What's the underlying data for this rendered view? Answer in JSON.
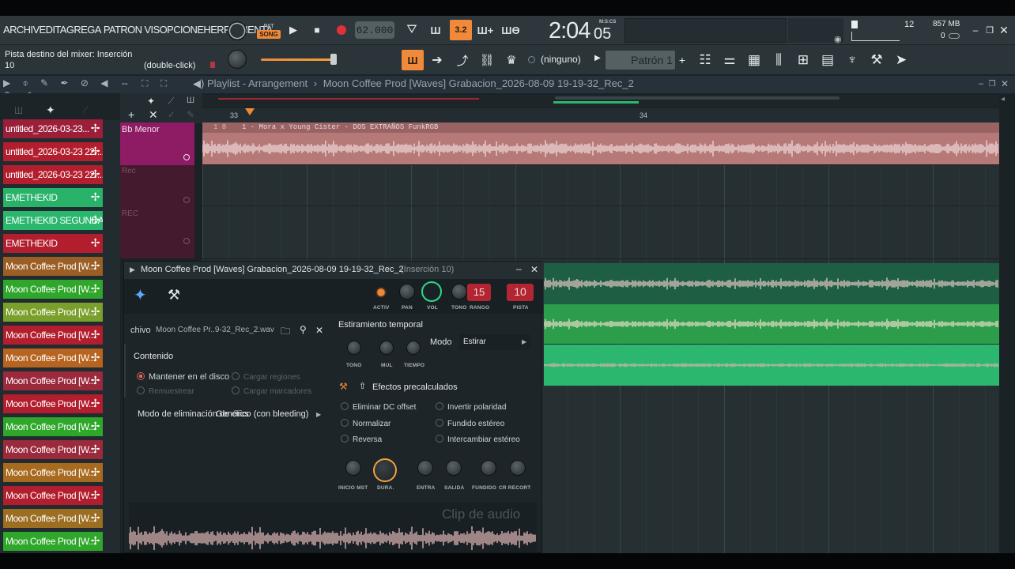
{
  "menu": {
    "items": [
      "ARCHIV",
      "EDITA",
      "GREGA",
      "PATRON",
      "VIS",
      "OPCIONE",
      "HERRAMIENTA"
    ]
  },
  "toolbar": {
    "song_mode_top": "PAT",
    "song_mode_bottom": "SONG",
    "tempo": "62.000",
    "snap_btn": "3.2",
    "time_main": "2:04",
    "time_sub": "05",
    "time_unit": "M:S:CS",
    "cpu_value": "12",
    "mem_value": "857 MB",
    "poly_value": "0",
    "hint_line1": "Pista destino del mixer: Inserción",
    "hint_line2": "10",
    "hint_right": "(double-click)",
    "preset_none": "(ninguno)",
    "pattern": "Patrón 1"
  },
  "playlist": {
    "window_title": "Playlist - Arrangement",
    "breadcrumb_sep": "›",
    "file": "Moon Coffee Prod [Waves] Grabacion_2026-08-09 19-19-32_Rec_2",
    "bar_33": "33",
    "bar_34": "34",
    "track1_name": "Bb Menor",
    "track2_name": "Rec",
    "track3_name": "REC",
    "clip_title": "1 - Mora x Young Cister - DOS EXTRAÑOS FunkRGB",
    "clip_prefix": "1 8"
  },
  "picker": [
    {
      "label": "untitled_2026-03-23...",
      "color": "#9c1f3a"
    },
    {
      "label": "untitled_2026-03-23 22-...",
      "color": "#b21e2d"
    },
    {
      "label": "untitled_2026-03-23 22-...",
      "color": "#b21e2d"
    },
    {
      "label": "EMETHEKID",
      "color": "#29b36a"
    },
    {
      "label": "EMETHEKID SEGUNDA...",
      "color": "#2bb86e"
    },
    {
      "label": "EMETHEKID",
      "color": "#b21e2d"
    },
    {
      "label": "Moon Coffee Prod [W...",
      "color": "#9b5e24"
    },
    {
      "label": "Moon Coffee Prod [W...",
      "color": "#2ea72a"
    },
    {
      "label": "Moon Coffee Prod [W...",
      "color": "#7aa02b"
    },
    {
      "label": "Moon Coffee Prod [W...",
      "color": "#b21e2d"
    },
    {
      "label": "Moon Coffee Prod [W...",
      "color": "#b76420"
    },
    {
      "label": "Moon Coffee Prod [W...",
      "color": "#9b2a3c"
    },
    {
      "label": "Moon Coffee Prod [W...",
      "color": "#b21e2d"
    },
    {
      "label": "Moon Coffee Prod [W...",
      "color": "#2ea72a"
    },
    {
      "label": "Moon Coffee Prod [W...",
      "color": "#9b2a3c"
    },
    {
      "label": "Moon Coffee Prod [W...",
      "color": "#a86a1e"
    },
    {
      "label": "Moon Coffee Prod [W...",
      "color": "#b21e2d"
    },
    {
      "label": "Moon Coffee Prod [W...",
      "color": "#9b6e22"
    },
    {
      "label": "Moon Coffee Prod [W...",
      "color": "#2ea72a"
    }
  ],
  "clip": {
    "title": "Moon Coffee Prod [Waves] Grabacion_2026-08-09 19-19-32_Rec_2",
    "insertion": "(Inserción 10)",
    "knob_labels": {
      "activ": "ACTIV",
      "pan": "PAN",
      "vol": "VOL",
      "tono": "TONO",
      "rango": "RANGO",
      "pista": "PISTA"
    },
    "rango_value": "15",
    "pista_value": "10",
    "file_label": "chivo",
    "file_name": "Moon Coffee Pr..9-32_Rec_2.wav",
    "content_heading": "Contenido",
    "opt_keep": "Mantener en el disco",
    "opt_regions": "Cargar regiones",
    "opt_resample": "Remuestrear",
    "opt_markers": "Cargar marcadores",
    "declick_label": "Modo de eliminación de clics",
    "declick_value": "Genérico (con bleeding)",
    "stretch_heading": "Estiramiento temporal",
    "stretch_knobs": [
      "TONO",
      "MUL",
      "TIEMPO"
    ],
    "mode_label": "Modo",
    "mode_value": "Estirar",
    "effects_heading": "Efectos precalculados",
    "fx": [
      "Eliminar DC offset",
      "Invertir polaridad",
      "Normalizar",
      "Fundido estéreo",
      "Reversa",
      "Intercambiar estéreo"
    ],
    "bottom_knobs": [
      "INICIO MST",
      "DURA.",
      "ENTRA",
      "SALIDA",
      "FUNDIDO",
      "CR RECORT"
    ],
    "watermark": "Clip de audio"
  },
  "colors": {
    "accent": "#f08a3a",
    "clip_pink": "#e7a3a3",
    "rec_green": "#2bb86e",
    "track_magenta": "#8d1c64"
  }
}
